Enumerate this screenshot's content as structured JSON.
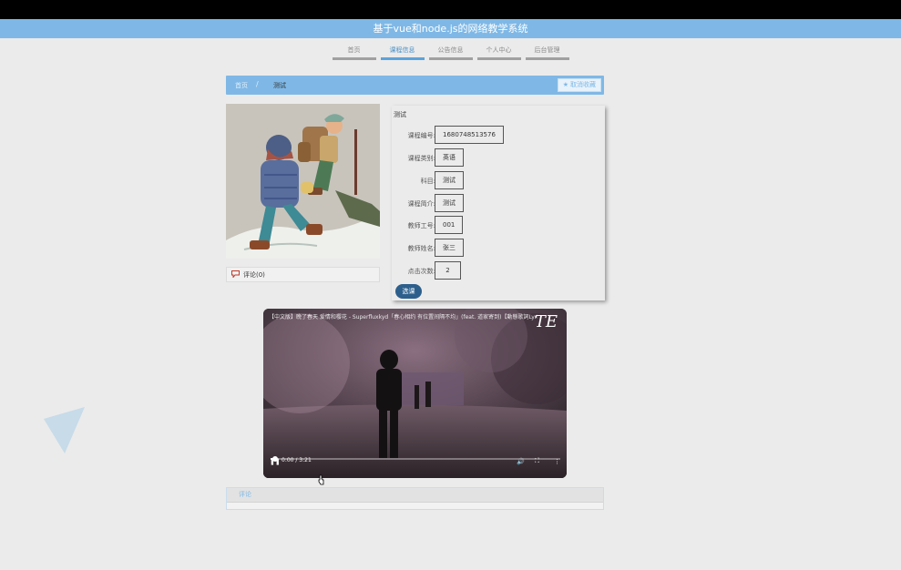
{
  "app": {
    "title": "基于vue和node.js的网络教学系统"
  },
  "nav": {
    "items": [
      {
        "label": "首页",
        "active": false
      },
      {
        "label": "课程信息",
        "active": true
      },
      {
        "label": "公告信息",
        "active": false
      },
      {
        "label": "个人中心",
        "active": false
      },
      {
        "label": "后台管理",
        "active": false
      }
    ]
  },
  "breadcrumb": {
    "home": "首页",
    "separator": "/",
    "current": "测试"
  },
  "favorite": {
    "label": "取消收藏"
  },
  "comments": {
    "label": "评论(0)"
  },
  "course": {
    "title": "测试",
    "fields": [
      {
        "label": "课程编号:",
        "value": "1680748513576"
      },
      {
        "label": "课程类别:",
        "value": "英语"
      },
      {
        "label": "科目:",
        "value": "测试"
      },
      {
        "label": "课程简介:",
        "value": "测试"
      },
      {
        "label": "教师工号:",
        "value": "001"
      },
      {
        "label": "教师姓名:",
        "value": "张三"
      },
      {
        "label": "点击次数:",
        "value": "2"
      }
    ],
    "select_label": "选课"
  },
  "video": {
    "title": "【中文版】晚了春天 爱情和樱花 - Superfluxkyd「春心相约 有位置间隔不均」(feat. 道家寄到)【動態歌詞Lyrics】",
    "logo": "TE",
    "time": "0:00 / 3:21",
    "progress": 0.015
  },
  "review": {
    "label": "评论"
  },
  "colors": {
    "accent": "#7fb8e6",
    "button": "#2d5f8c",
    "nav_active": "#5aa3dc"
  }
}
